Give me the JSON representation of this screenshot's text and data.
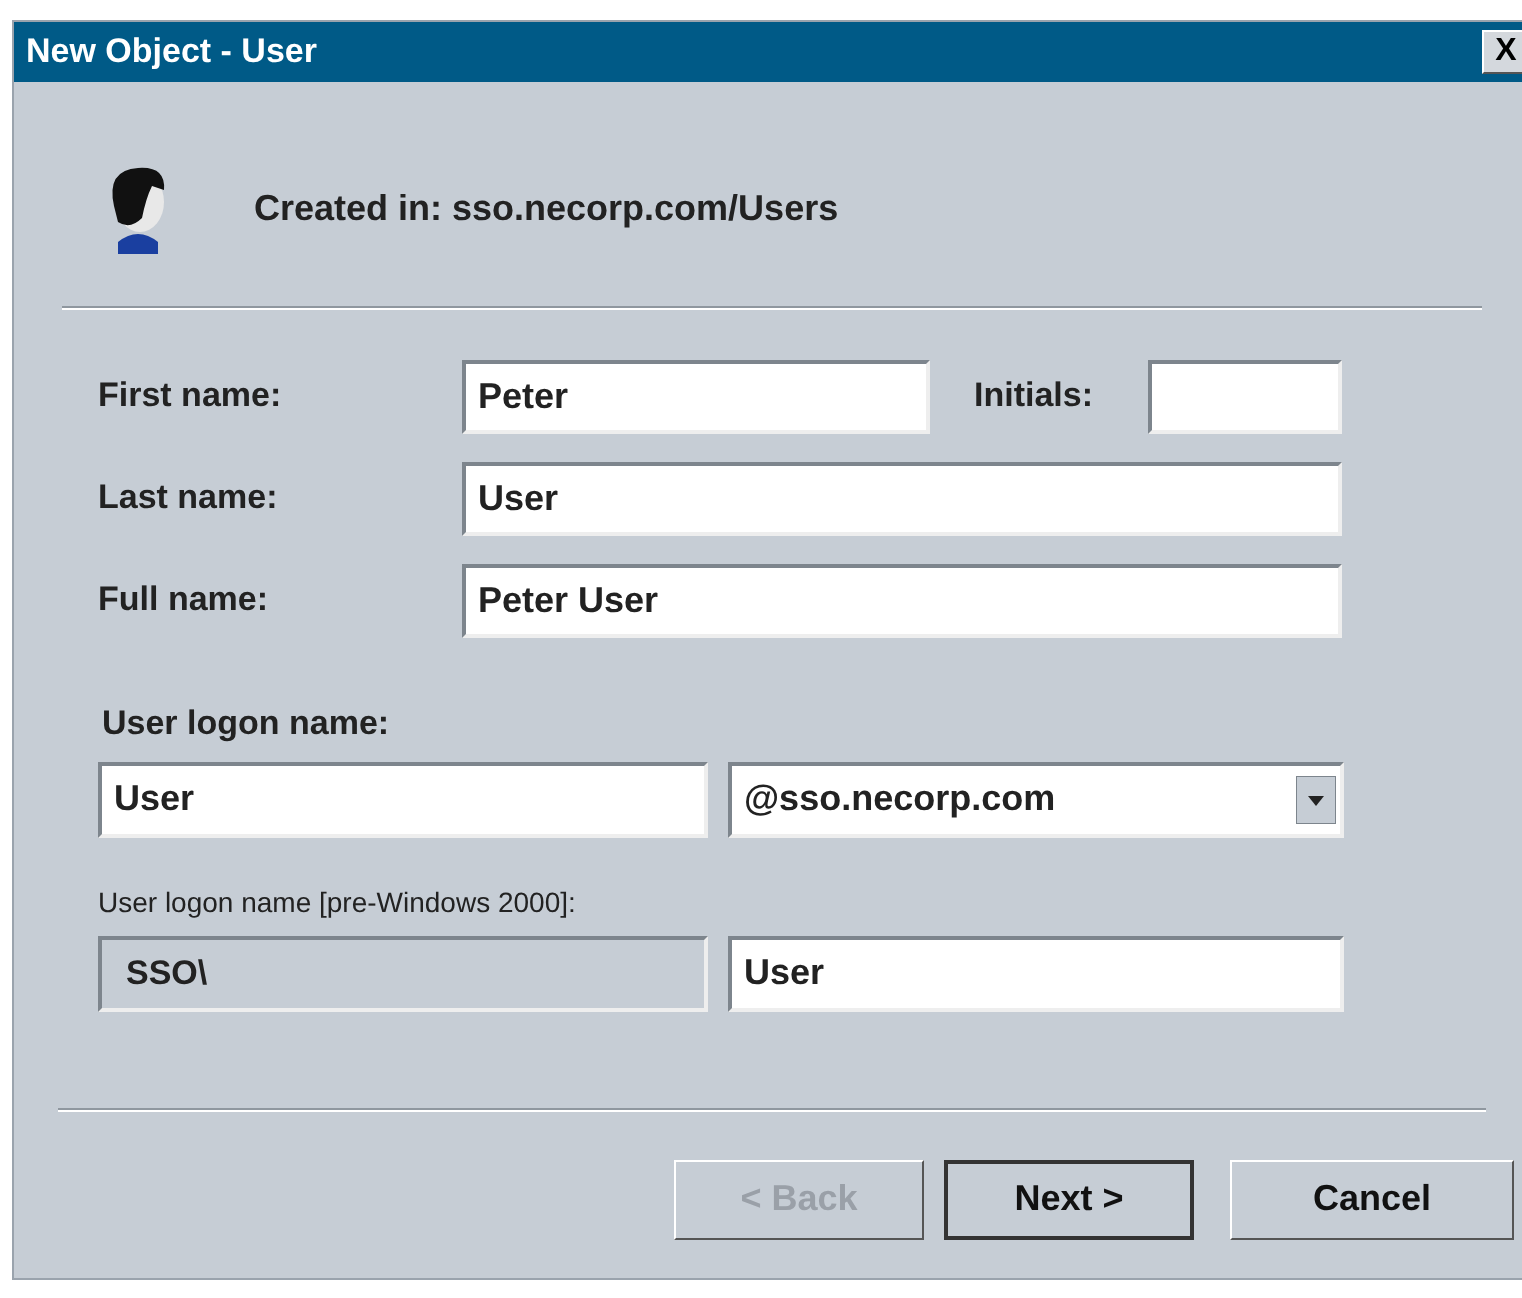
{
  "window": {
    "title": "New Object - User",
    "close": "X"
  },
  "header": {
    "created_in": "Created in: sso.necorp.com/Users"
  },
  "fields": [
    {
      "label": "First name:",
      "value": "Peter"
    },
    {
      "label": "Initials:"
    },
    {
      "label": "Last name:",
      "value": "User"
    },
    {
      "label": "Full name:",
      "value": "Peter User"
    }
  ],
  "logon": {
    "label": "User logon name:",
    "value": "User",
    "domain": "@sso.necorp.com"
  },
  "pre2000": {
    "label": "User logon name [pre-Windows 2000]:",
    "prefix": "SSO\\",
    "value": "User"
  },
  "buttons": [
    {
      "label": "< Back",
      "disabled": true,
      "default": false
    },
    {
      "label": "Next >",
      "disabled": false,
      "default": true
    },
    {
      "label": "Cancel",
      "disabled": false,
      "default": false
    }
  ]
}
